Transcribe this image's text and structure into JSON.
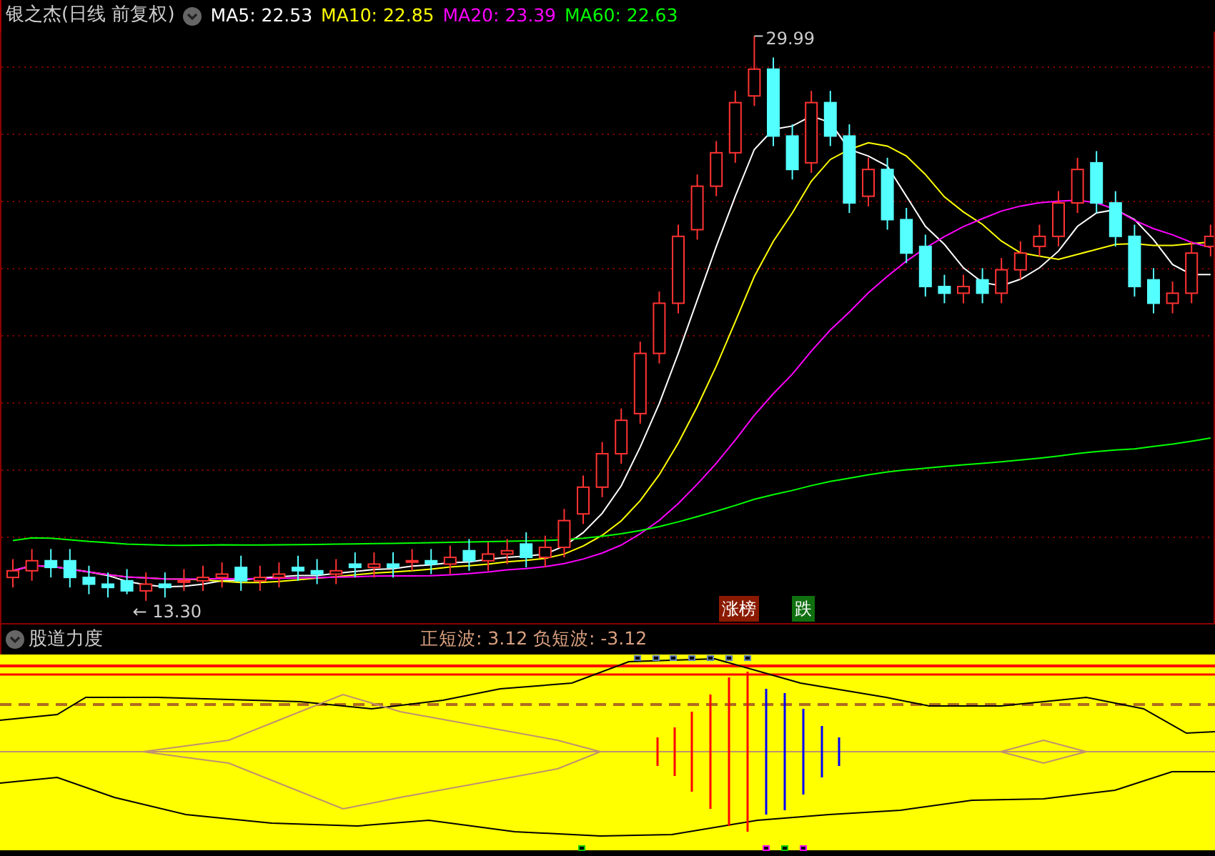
{
  "header": {
    "title": "银之杰(日线 前复权)",
    "ma": [
      {
        "label": "MA5: 22.53",
        "color": "#ffffff"
      },
      {
        "label": "MA10: 22.85",
        "color": "#ffff00"
      },
      {
        "label": "MA20: 23.39",
        "color": "#ff00ff"
      },
      {
        "label": "MA60: 22.63",
        "color": "#00ff00"
      }
    ]
  },
  "main_chart": {
    "high_label": "29.99",
    "low_label": "← 13.30",
    "tags": [
      {
        "text": "涨榜",
        "color": "#8b1a00"
      },
      {
        "text": "跌",
        "color": "#107010"
      }
    ]
  },
  "indicator": {
    "title": "股道力度",
    "readings": "正短波: 3.12 负短波: -3.12"
  }
}
